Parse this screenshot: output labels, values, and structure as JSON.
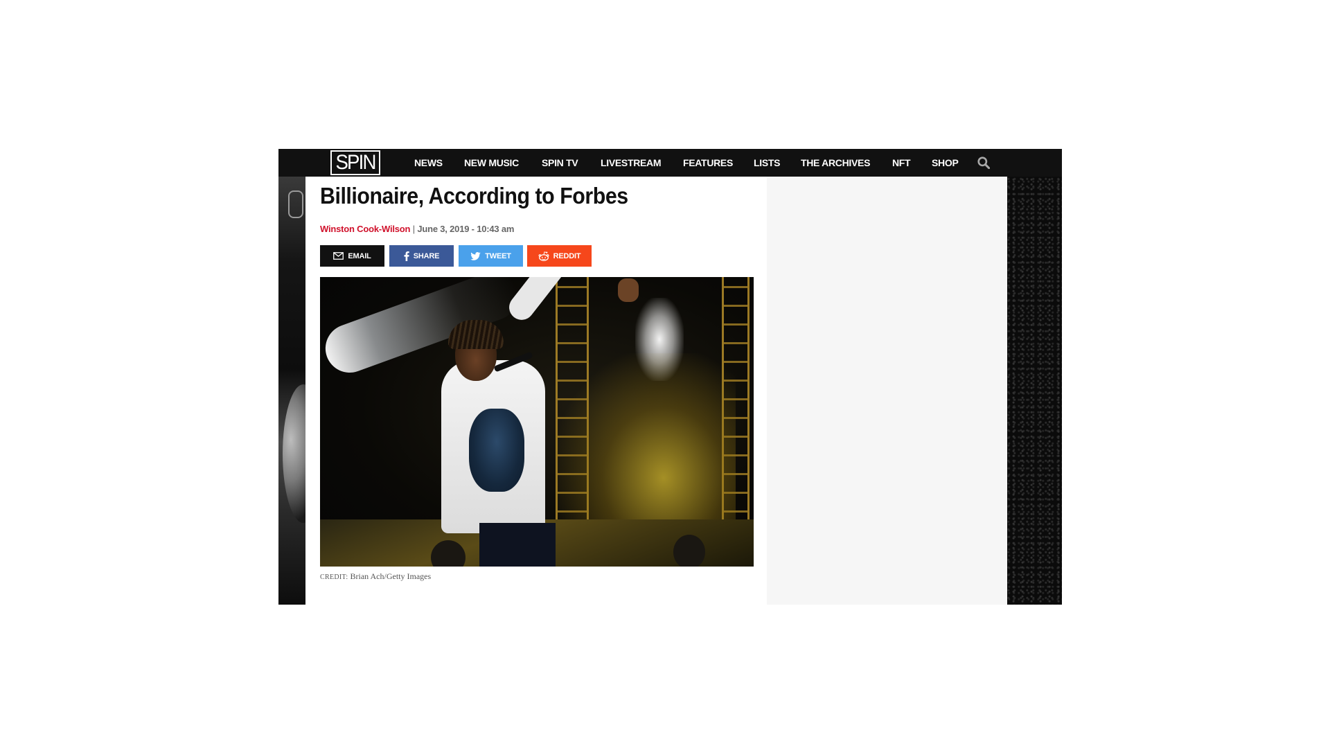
{
  "nav": {
    "logo": "SPIN",
    "items": [
      "NEWS",
      "NEW MUSIC",
      "SPIN TV",
      "LIVESTREAM",
      "FEATURES",
      "LISTS",
      "THE ARCHIVES",
      "NFT",
      "SHOP"
    ],
    "search_icon": "search-icon"
  },
  "article": {
    "headline": "Billionaire, According to Forbes",
    "author": "Winston Cook-Wilson",
    "separator": "|",
    "date": "June 3, 2019 - 10:43 am",
    "share": {
      "email": "EMAIL",
      "share": "SHARE",
      "tweet": "TWEET",
      "reddit": "REDDIT"
    },
    "credit_label": "CREDIT:",
    "credit": "Brian Ach/Getty Images"
  },
  "colors": {
    "nav_bg": "#111111",
    "author": "#d0112b",
    "email": "#111111",
    "facebook": "#3b5998",
    "twitter": "#4aa1eb",
    "reddit": "#f6471b",
    "sidebar_bg": "#f6f6f6"
  }
}
